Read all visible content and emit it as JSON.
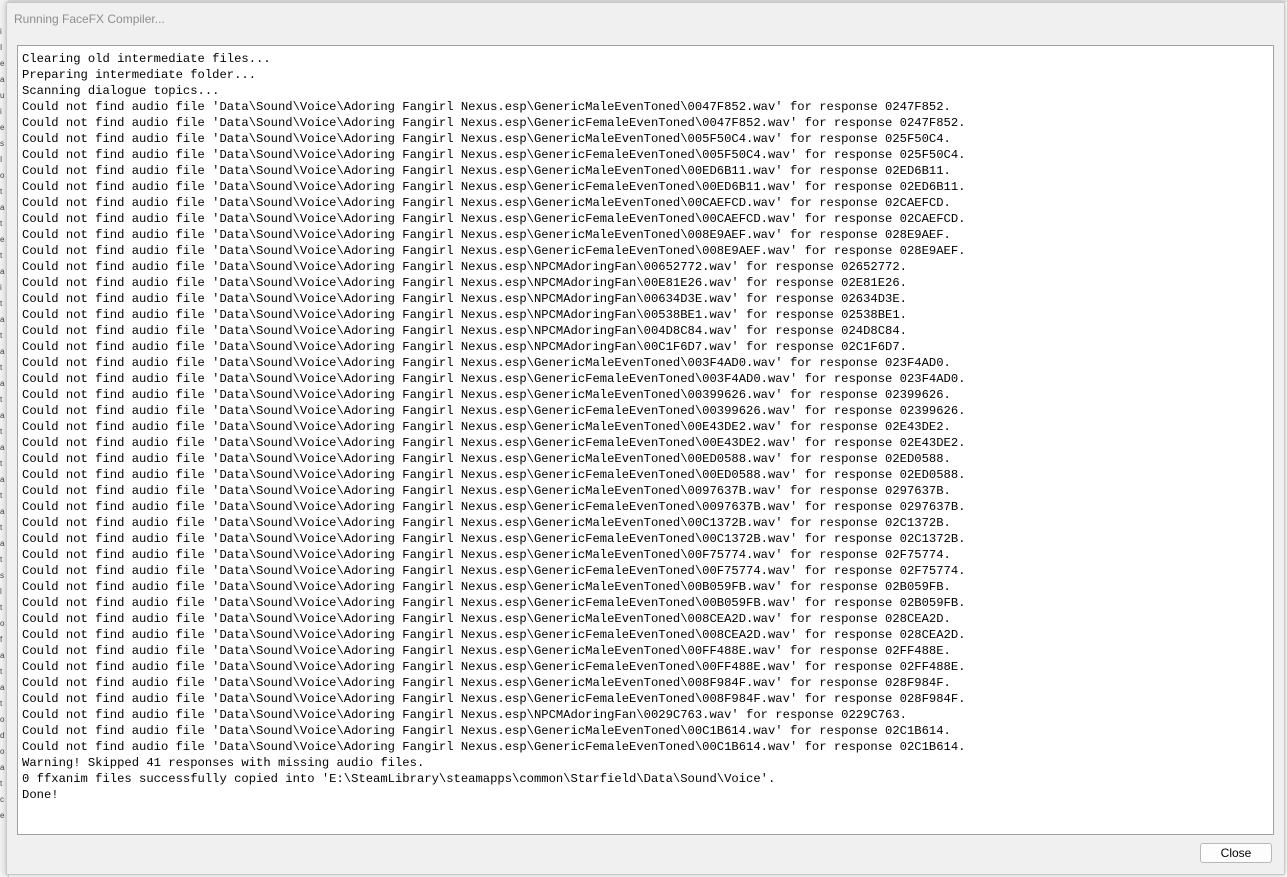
{
  "window": {
    "title": "Running FaceFX Compiler..."
  },
  "log": {
    "lines": [
      "Clearing old intermediate files...",
      "Preparing intermediate folder...",
      "Scanning dialogue topics...",
      "Could not find audio file 'Data\\Sound\\Voice\\Adoring Fangirl Nexus.esp\\GenericMaleEvenToned\\0047F852.wav' for response 0247F852.",
      "Could not find audio file 'Data\\Sound\\Voice\\Adoring Fangirl Nexus.esp\\GenericFemaleEvenToned\\0047F852.wav' for response 0247F852.",
      "Could not find audio file 'Data\\Sound\\Voice\\Adoring Fangirl Nexus.esp\\GenericMaleEvenToned\\005F50C4.wav' for response 025F50C4.",
      "Could not find audio file 'Data\\Sound\\Voice\\Adoring Fangirl Nexus.esp\\GenericFemaleEvenToned\\005F50C4.wav' for response 025F50C4.",
      "Could not find audio file 'Data\\Sound\\Voice\\Adoring Fangirl Nexus.esp\\GenericMaleEvenToned\\00ED6B11.wav' for response 02ED6B11.",
      "Could not find audio file 'Data\\Sound\\Voice\\Adoring Fangirl Nexus.esp\\GenericFemaleEvenToned\\00ED6B11.wav' for response 02ED6B11.",
      "Could not find audio file 'Data\\Sound\\Voice\\Adoring Fangirl Nexus.esp\\GenericMaleEvenToned\\00CAEFCD.wav' for response 02CAEFCD.",
      "Could not find audio file 'Data\\Sound\\Voice\\Adoring Fangirl Nexus.esp\\GenericFemaleEvenToned\\00CAEFCD.wav' for response 02CAEFCD.",
      "Could not find audio file 'Data\\Sound\\Voice\\Adoring Fangirl Nexus.esp\\GenericMaleEvenToned\\008E9AEF.wav' for response 028E9AEF.",
      "Could not find audio file 'Data\\Sound\\Voice\\Adoring Fangirl Nexus.esp\\GenericFemaleEvenToned\\008E9AEF.wav' for response 028E9AEF.",
      "Could not find audio file 'Data\\Sound\\Voice\\Adoring Fangirl Nexus.esp\\NPCMAdoringFan\\00652772.wav' for response 02652772.",
      "Could not find audio file 'Data\\Sound\\Voice\\Adoring Fangirl Nexus.esp\\NPCMAdoringFan\\00E81E26.wav' for response 02E81E26.",
      "Could not find audio file 'Data\\Sound\\Voice\\Adoring Fangirl Nexus.esp\\NPCMAdoringFan\\00634D3E.wav' for response 02634D3E.",
      "Could not find audio file 'Data\\Sound\\Voice\\Adoring Fangirl Nexus.esp\\NPCMAdoringFan\\00538BE1.wav' for response 02538BE1.",
      "Could not find audio file 'Data\\Sound\\Voice\\Adoring Fangirl Nexus.esp\\NPCMAdoringFan\\004D8C84.wav' for response 024D8C84.",
      "Could not find audio file 'Data\\Sound\\Voice\\Adoring Fangirl Nexus.esp\\NPCMAdoringFan\\00C1F6D7.wav' for response 02C1F6D7.",
      "Could not find audio file 'Data\\Sound\\Voice\\Adoring Fangirl Nexus.esp\\GenericMaleEvenToned\\003F4AD0.wav' for response 023F4AD0.",
      "Could not find audio file 'Data\\Sound\\Voice\\Adoring Fangirl Nexus.esp\\GenericFemaleEvenToned\\003F4AD0.wav' for response 023F4AD0.",
      "Could not find audio file 'Data\\Sound\\Voice\\Adoring Fangirl Nexus.esp\\GenericMaleEvenToned\\00399626.wav' for response 02399626.",
      "Could not find audio file 'Data\\Sound\\Voice\\Adoring Fangirl Nexus.esp\\GenericFemaleEvenToned\\00399626.wav' for response 02399626.",
      "Could not find audio file 'Data\\Sound\\Voice\\Adoring Fangirl Nexus.esp\\GenericMaleEvenToned\\00E43DE2.wav' for response 02E43DE2.",
      "Could not find audio file 'Data\\Sound\\Voice\\Adoring Fangirl Nexus.esp\\GenericFemaleEvenToned\\00E43DE2.wav' for response 02E43DE2.",
      "Could not find audio file 'Data\\Sound\\Voice\\Adoring Fangirl Nexus.esp\\GenericMaleEvenToned\\00ED0588.wav' for response 02ED0588.",
      "Could not find audio file 'Data\\Sound\\Voice\\Adoring Fangirl Nexus.esp\\GenericFemaleEvenToned\\00ED0588.wav' for response 02ED0588.",
      "Could not find audio file 'Data\\Sound\\Voice\\Adoring Fangirl Nexus.esp\\GenericMaleEvenToned\\0097637B.wav' for response 0297637B.",
      "Could not find audio file 'Data\\Sound\\Voice\\Adoring Fangirl Nexus.esp\\GenericFemaleEvenToned\\0097637B.wav' for response 0297637B.",
      "Could not find audio file 'Data\\Sound\\Voice\\Adoring Fangirl Nexus.esp\\GenericMaleEvenToned\\00C1372B.wav' for response 02C1372B.",
      "Could not find audio file 'Data\\Sound\\Voice\\Adoring Fangirl Nexus.esp\\GenericFemaleEvenToned\\00C1372B.wav' for response 02C1372B.",
      "Could not find audio file 'Data\\Sound\\Voice\\Adoring Fangirl Nexus.esp\\GenericMaleEvenToned\\00F75774.wav' for response 02F75774.",
      "Could not find audio file 'Data\\Sound\\Voice\\Adoring Fangirl Nexus.esp\\GenericFemaleEvenToned\\00F75774.wav' for response 02F75774.",
      "Could not find audio file 'Data\\Sound\\Voice\\Adoring Fangirl Nexus.esp\\GenericMaleEvenToned\\00B059FB.wav' for response 02B059FB.",
      "Could not find audio file 'Data\\Sound\\Voice\\Adoring Fangirl Nexus.esp\\GenericFemaleEvenToned\\00B059FB.wav' for response 02B059FB.",
      "Could not find audio file 'Data\\Sound\\Voice\\Adoring Fangirl Nexus.esp\\GenericMaleEvenToned\\008CEA2D.wav' for response 028CEA2D.",
      "Could not find audio file 'Data\\Sound\\Voice\\Adoring Fangirl Nexus.esp\\GenericFemaleEvenToned\\008CEA2D.wav' for response 028CEA2D.",
      "Could not find audio file 'Data\\Sound\\Voice\\Adoring Fangirl Nexus.esp\\GenericMaleEvenToned\\00FF488E.wav' for response 02FF488E.",
      "Could not find audio file 'Data\\Sound\\Voice\\Adoring Fangirl Nexus.esp\\GenericFemaleEvenToned\\00FF488E.wav' for response 02FF488E.",
      "Could not find audio file 'Data\\Sound\\Voice\\Adoring Fangirl Nexus.esp\\GenericMaleEvenToned\\008F984F.wav' for response 028F984F.",
      "Could not find audio file 'Data\\Sound\\Voice\\Adoring Fangirl Nexus.esp\\GenericFemaleEvenToned\\008F984F.wav' for response 028F984F.",
      "Could not find audio file 'Data\\Sound\\Voice\\Adoring Fangirl Nexus.esp\\NPCMAdoringFan\\0029C763.wav' for response 0229C763.",
      "Could not find audio file 'Data\\Sound\\Voice\\Adoring Fangirl Nexus.esp\\GenericMaleEvenToned\\00C1B614.wav' for response 02C1B614.",
      "Could not find audio file 'Data\\Sound\\Voice\\Adoring Fangirl Nexus.esp\\GenericFemaleEvenToned\\00C1B614.wav' for response 02C1B614.",
      "Warning! Skipped 41 responses with missing audio files.",
      "0 ffxanim files successfully copied into 'E:\\SteamLibrary\\steamapps\\common\\Starfield\\Data\\Sound\\Voice'.",
      "Done!"
    ]
  },
  "buttons": {
    "close_label": "Close"
  },
  "background": {
    "edge_glyphs": [
      "i",
      "I",
      "e",
      "a",
      "u",
      "i",
      "e",
      "s",
      "I",
      "o",
      "t",
      "a",
      "t",
      "e",
      "t",
      "a",
      "i",
      "t",
      "a",
      "t",
      "a",
      "t",
      "a",
      "t",
      "a",
      "t",
      "a",
      "t",
      "a",
      "t",
      "a",
      "t",
      "a",
      "t",
      "s",
      "l",
      "t",
      "o",
      "f",
      "a",
      "t",
      "a",
      "t",
      "o",
      "d",
      "o",
      "a",
      "t",
      "c",
      "e"
    ]
  },
  "colors": {
    "dialog_bg": "#f0f0f0",
    "title_text": "#8e8e8e",
    "log_bg": "#ffffff",
    "log_border": "#a0a0a0"
  }
}
